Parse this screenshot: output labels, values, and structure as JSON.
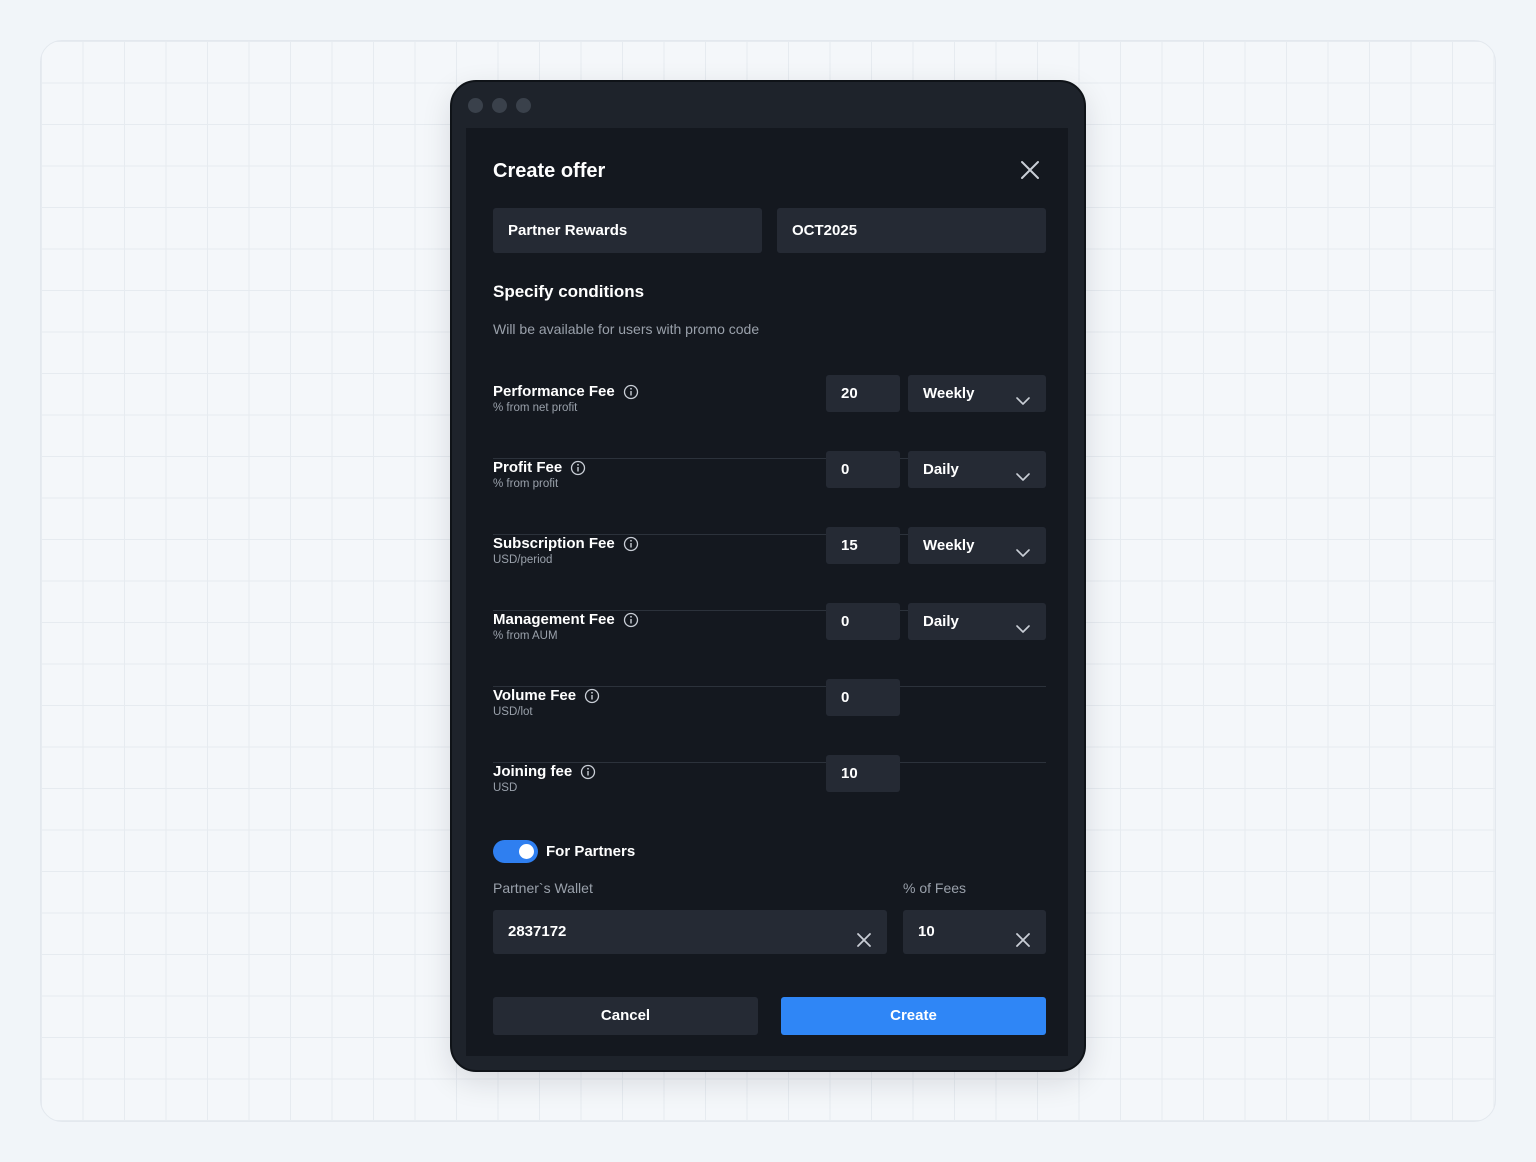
{
  "modal": {
    "title": "Create offer",
    "offer_name": "Partner Rewards",
    "promo_code": "OCT2025"
  },
  "conditions": {
    "title": "Specify conditions",
    "subtitle": "Will be available for users with promo code",
    "rows": [
      {
        "label": "Performance Fee",
        "sub": "% from net profit",
        "value": "20",
        "period": "Weekly"
      },
      {
        "label": "Profit Fee",
        "sub": "% from profit",
        "value": "0",
        "period": "Daily"
      },
      {
        "label": "Subscription Fee",
        "sub": "USD/period",
        "value": "15",
        "period": "Weekly"
      },
      {
        "label": "Management Fee",
        "sub": "% from AUM",
        "value": "0",
        "period": "Daily"
      },
      {
        "label": "Volume Fee",
        "sub": "USD/lot",
        "value": "0"
      },
      {
        "label": "Joining fee",
        "sub": "USD",
        "value": "10"
      }
    ]
  },
  "partners": {
    "toggle_label": "For Partners",
    "toggle_on": true,
    "wallet_label": "Partner`s Wallet",
    "wallet_value": "2837172",
    "fees_label": "% of Fees",
    "fees_value": "10"
  },
  "actions": {
    "cancel": "Cancel",
    "create": "Create"
  },
  "colors": {
    "accent": "#2f86f6",
    "panel": "#14181f",
    "input": "#252a34"
  }
}
